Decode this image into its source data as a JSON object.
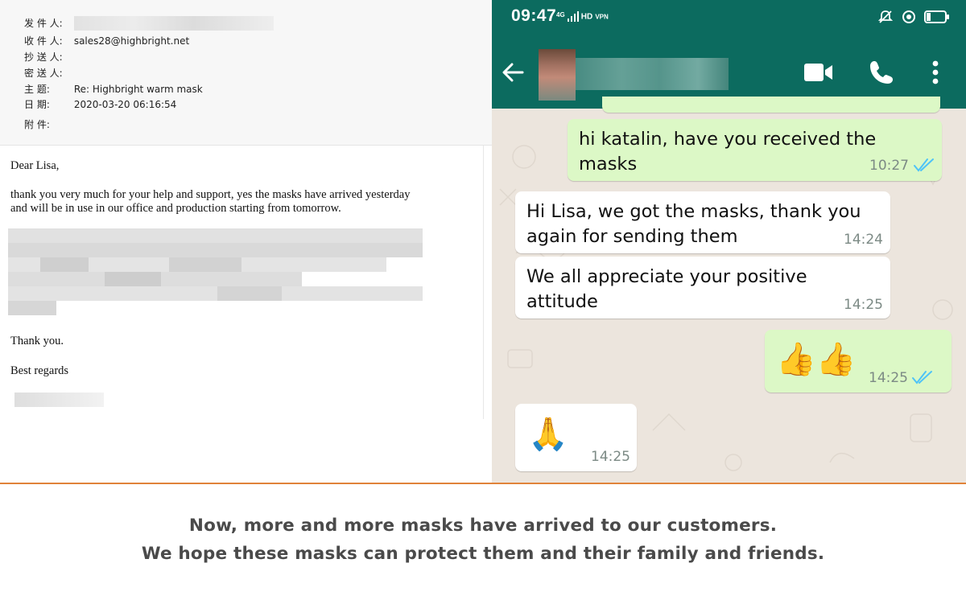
{
  "email": {
    "header": {
      "from_label": "发 件 人:",
      "to_label": "收 件 人:",
      "to_value": "sales28@highbright.net",
      "cc_label": "抄 送 人:",
      "bcc_label": "密 送 人:",
      "subject_label": "主     题:",
      "subject_value": "Re: Highbright warm mask",
      "date_label": "日     期:",
      "date_value": "2020-03-20 06:16:54",
      "attach_label": "附     件:"
    },
    "body": {
      "greeting": "Dear Lisa,",
      "para1_line1": "thank you very much for your help and support, yes the masks have arrived yesterday",
      "para1_line2": "and will be in use in our office and production starting from tomorrow.",
      "thanks": "Thank you.",
      "regards": "Best regards"
    }
  },
  "whatsapp": {
    "status_time": "09:47",
    "status_network": "4G",
    "status_hd": "HD",
    "status_vpn": "VPN",
    "messages": [
      {
        "direction": "out",
        "line1": "hi katalin, have you received the",
        "line2": "masks",
        "time": "10:27",
        "read": true
      },
      {
        "direction": "in",
        "line1": "Hi Lisa, we got the masks, thank you",
        "line2": "again for sending them",
        "time": "14:24"
      },
      {
        "direction": "in",
        "line1": "We all appreciate your positive",
        "line2": "attitude",
        "time": "14:25"
      },
      {
        "direction": "out",
        "emoji": "👍👍",
        "time": "14:25",
        "read": true
      },
      {
        "direction": "in",
        "emoji": "🙏",
        "time": "14:25"
      }
    ],
    "colors": {
      "header": "#0c6b5f",
      "outgoing": "#dcf8c6",
      "incoming": "#ffffff",
      "chat_bg": "#ece5dd",
      "read_ticks": "#4fc3f7"
    }
  },
  "caption": {
    "line1": "Now, more and more masks have arrived to our customers.",
    "line2": "We hope these masks can protect them and their family and friends."
  },
  "accent_color": "#e0833a"
}
